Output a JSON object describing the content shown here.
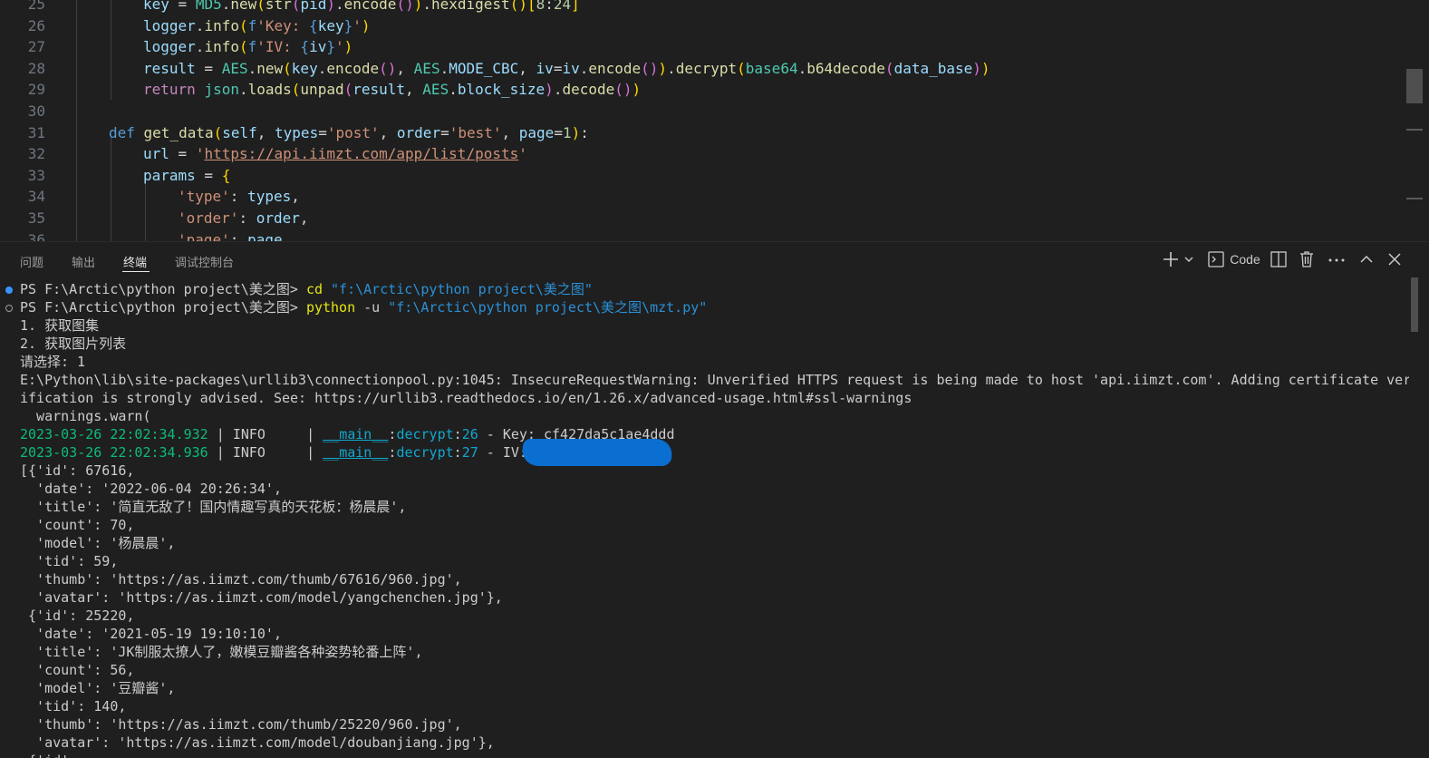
{
  "editor": {
    "lines": [
      {
        "num": "25",
        "indent": 2,
        "tokens": [
          [
            "var",
            "key"
          ],
          [
            "pl",
            " = "
          ],
          [
            "cls",
            "MD5"
          ],
          [
            "pl",
            "."
          ],
          [
            "fn",
            "new"
          ],
          [
            "br1",
            "("
          ],
          [
            "fn",
            "str"
          ],
          [
            "br2",
            "("
          ],
          [
            "var",
            "pid"
          ],
          [
            "br2",
            ")"
          ],
          [
            "pl",
            "."
          ],
          [
            "fn",
            "encode"
          ],
          [
            "br2",
            "()"
          ],
          [
            "br1",
            ")"
          ],
          [
            "pl",
            "."
          ],
          [
            "fn",
            "hexdigest"
          ],
          [
            "br1",
            "()"
          ],
          [
            "br1",
            "["
          ],
          [
            "num",
            "8"
          ],
          [
            "pl",
            ":"
          ],
          [
            "num",
            "24"
          ],
          [
            "br1",
            "]"
          ]
        ]
      },
      {
        "num": "26",
        "indent": 2,
        "tokens": [
          [
            "var",
            "logger"
          ],
          [
            "pl",
            "."
          ],
          [
            "fn",
            "info"
          ],
          [
            "br1",
            "("
          ],
          [
            "kw",
            "f"
          ],
          [
            "str",
            "'Key: "
          ],
          [
            "kw",
            "{"
          ],
          [
            "var",
            "key"
          ],
          [
            "kw",
            "}"
          ],
          [
            "str",
            "'"
          ],
          [
            "br1",
            ")"
          ]
        ]
      },
      {
        "num": "27",
        "indent": 2,
        "tokens": [
          [
            "var",
            "logger"
          ],
          [
            "pl",
            "."
          ],
          [
            "fn",
            "info"
          ],
          [
            "br1",
            "("
          ],
          [
            "kw",
            "f"
          ],
          [
            "str",
            "'IV: "
          ],
          [
            "kw",
            "{"
          ],
          [
            "var",
            "iv"
          ],
          [
            "kw",
            "}"
          ],
          [
            "str",
            "'"
          ],
          [
            "br1",
            ")"
          ]
        ]
      },
      {
        "num": "28",
        "indent": 2,
        "tokens": [
          [
            "var",
            "result"
          ],
          [
            "pl",
            " = "
          ],
          [
            "cls",
            "AES"
          ],
          [
            "pl",
            "."
          ],
          [
            "fn",
            "new"
          ],
          [
            "br1",
            "("
          ],
          [
            "var",
            "key"
          ],
          [
            "pl",
            "."
          ],
          [
            "fn",
            "encode"
          ],
          [
            "br2",
            "()"
          ],
          [
            "pl",
            ", "
          ],
          [
            "cls",
            "AES"
          ],
          [
            "pl",
            "."
          ],
          [
            "var",
            "MODE_CBC"
          ],
          [
            "pl",
            ", "
          ],
          [
            "var",
            "iv"
          ],
          [
            "pl",
            "="
          ],
          [
            "var",
            "iv"
          ],
          [
            "pl",
            "."
          ],
          [
            "fn",
            "encode"
          ],
          [
            "br2",
            "()"
          ],
          [
            "br1",
            ")"
          ],
          [
            "pl",
            "."
          ],
          [
            "fn",
            "decrypt"
          ],
          [
            "br1",
            "("
          ],
          [
            "cls",
            "base64"
          ],
          [
            "pl",
            "."
          ],
          [
            "fn",
            "b64decode"
          ],
          [
            "br2",
            "("
          ],
          [
            "var",
            "data_base"
          ],
          [
            "br2",
            ")"
          ],
          [
            "br1",
            ")"
          ]
        ]
      },
      {
        "num": "29",
        "indent": 2,
        "tokens": [
          [
            "ctl",
            "return "
          ],
          [
            "cls",
            "json"
          ],
          [
            "pl",
            "."
          ],
          [
            "fn",
            "loads"
          ],
          [
            "br1",
            "("
          ],
          [
            "fn",
            "unpad"
          ],
          [
            "br2",
            "("
          ],
          [
            "var",
            "result"
          ],
          [
            "pl",
            ", "
          ],
          [
            "cls",
            "AES"
          ],
          [
            "pl",
            "."
          ],
          [
            "var",
            "block_size"
          ],
          [
            "br2",
            ")"
          ],
          [
            "pl",
            "."
          ],
          [
            "fn",
            "decode"
          ],
          [
            "br2",
            "()"
          ],
          [
            "br1",
            ")"
          ]
        ]
      },
      {
        "num": "30",
        "indent": 0,
        "tokens": []
      },
      {
        "num": "31",
        "indent": 1,
        "tokens": [
          [
            "kw",
            "def "
          ],
          [
            "fn",
            "get_data"
          ],
          [
            "br1",
            "("
          ],
          [
            "var",
            "self"
          ],
          [
            "pl",
            ", "
          ],
          [
            "var",
            "types"
          ],
          [
            "pl",
            "="
          ],
          [
            "str",
            "'post'"
          ],
          [
            "pl",
            ", "
          ],
          [
            "var",
            "order"
          ],
          [
            "pl",
            "="
          ],
          [
            "str",
            "'best'"
          ],
          [
            "pl",
            ", "
          ],
          [
            "var",
            "page"
          ],
          [
            "pl",
            "="
          ],
          [
            "num",
            "1"
          ],
          [
            "br1",
            ")"
          ],
          [
            "pl",
            ":"
          ]
        ]
      },
      {
        "num": "32",
        "indent": 2,
        "tokens": [
          [
            "var",
            "url"
          ],
          [
            "pl",
            " = "
          ],
          [
            "str",
            "'"
          ],
          [
            "url",
            "https://api.iimzt.com/app/list/posts"
          ],
          [
            "str",
            "'"
          ]
        ]
      },
      {
        "num": "33",
        "indent": 2,
        "tokens": [
          [
            "var",
            "params"
          ],
          [
            "pl",
            " = "
          ],
          [
            "br1",
            "{"
          ]
        ]
      },
      {
        "num": "34",
        "indent": 3,
        "tokens": [
          [
            "str",
            "'type'"
          ],
          [
            "pl",
            ": "
          ],
          [
            "var",
            "types"
          ],
          [
            "pl",
            ","
          ]
        ]
      },
      {
        "num": "35",
        "indent": 3,
        "tokens": [
          [
            "str",
            "'order'"
          ],
          [
            "pl",
            ": "
          ],
          [
            "var",
            "order"
          ],
          [
            "pl",
            ","
          ]
        ]
      },
      {
        "num": "36",
        "indent": 3,
        "tokens": [
          [
            "str",
            "'page'"
          ],
          [
            "pl",
            ": "
          ],
          [
            "var",
            "page"
          ]
        ]
      }
    ]
  },
  "panel": {
    "tabs": [
      "问题",
      "输出",
      "终端",
      "调试控制台"
    ],
    "active_tab": "终端",
    "terminal_name": "Code",
    "icons": [
      "plus-icon",
      "chevron-down-icon",
      "terminal-icon",
      "split-icon",
      "trash-icon",
      "more-icon",
      "chevron-up-icon",
      "close-icon"
    ]
  },
  "terminal": {
    "cmd1": {
      "prompt": "PS F:\\Arctic\\python project\\美之图> ",
      "cmd": "cd",
      "arg": "\"f:\\Arctic\\python project\\美之图\""
    },
    "cmd2": {
      "prompt": "PS F:\\Arctic\\python project\\美之图> ",
      "cmd": "python",
      "flag": "-u",
      "arg": "\"f:\\Arctic\\python project\\美之图\\mzt.py\""
    },
    "output": [
      "1. 获取图集",
      "2. 获取图片列表",
      "请选择: 1",
      "E:\\Python\\lib\\site-packages\\urllib3\\connectionpool.py:1045: InsecureRequestWarning: Unverified HTTPS request is being made to host 'api.iimzt.com'. Adding certificate ver",
      "ification is strongly advised. See: https://urllib3.readthedocs.io/en/1.26.x/advanced-usage.html#ssl-warnings",
      "  warnings.warn("
    ],
    "logs": [
      {
        "time": "2023-03-26 22:02:34.932",
        "sep1": " | ",
        "level": "INFO    ",
        "sep2": " | ",
        "module": "__main__",
        "func": "decrypt",
        "line": "26",
        "msg": " - Key: cf427da5c1ae4ddd"
      },
      {
        "time": "2023-03-26 22:02:34.936",
        "sep1": " | ",
        "level": "INFO    ",
        "sep2": " | ",
        "module": "__main__",
        "func": "decrypt",
        "line": "27",
        "msg": " - IV:"
      }
    ],
    "result": [
      "[{'id': 67616,",
      "  'date': '2022-06-04 20:26:34',",
      "  'title': '简直无敌了！国内情趣写真的天花板：杨晨晨',",
      "  'count': 70,",
      "  'model': '杨晨晨',",
      "  'tid': 59,",
      "  'thumb': 'https://as.iimzt.com/thumb/67616/960.jpg',",
      "  'avatar': 'https://as.iimzt.com/model/yangchenchen.jpg'},",
      " {'id': 25220,",
      "  'date': '2021-05-19 19:10:10',",
      "  'title': 'JK制服太撩人了，嫩模豆瓣酱各种姿势轮番上阵',",
      "  'count': 56,",
      "  'model': '豆瓣酱',",
      "  'tid': 140,",
      "  'thumb': 'https://as.iimzt.com/thumb/25220/960.jpg',",
      "  'avatar': 'https://as.iimzt.com/model/doubanjiang.jpg'},",
      " {'id':"
    ]
  }
}
